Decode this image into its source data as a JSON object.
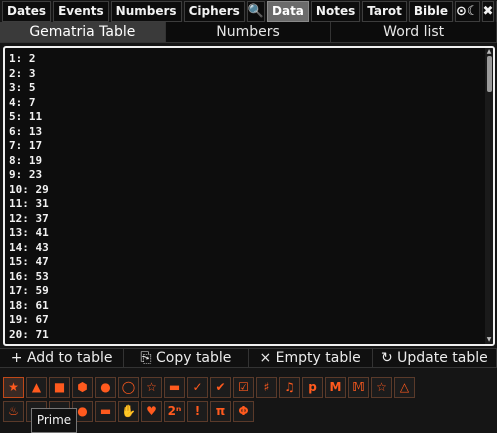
{
  "topnav": {
    "tabs": [
      {
        "label": "Dates",
        "active": false
      },
      {
        "label": "Events",
        "active": false
      },
      {
        "label": "Numbers",
        "active": false
      },
      {
        "label": "Ciphers",
        "active": false
      },
      {
        "label": "🔍",
        "icon": "search-icon",
        "active": false
      },
      {
        "label": "Data",
        "active": true
      },
      {
        "label": "Notes",
        "active": false
      },
      {
        "label": "Tarot",
        "active": false
      },
      {
        "label": "Bible",
        "active": false
      },
      {
        "label": "⊙☾",
        "icon": "sun-moon-icon",
        "active": false
      },
      {
        "label": "✖",
        "icon": "close-circle-icon",
        "active": false
      },
      {
        "label": "⚙",
        "icon": "gear-icon",
        "active": false
      }
    ]
  },
  "subtabs": [
    {
      "label": "Gematria Table",
      "active": true
    },
    {
      "label": "Numbers",
      "active": false
    },
    {
      "label": "Word list",
      "active": false
    }
  ],
  "table_lines": [
    "1: 2",
    "2: 3",
    "3: 5",
    "4: 7",
    "5: 11",
    "6: 13",
    "7: 17",
    "8: 19",
    "9: 23",
    "10: 29",
    "11: 31",
    "12: 37",
    "13: 41",
    "14: 43",
    "15: 47",
    "16: 53",
    "17: 59",
    "18: 61",
    "19: 67",
    "20: 71"
  ],
  "actions": {
    "add": "+ Add to table",
    "copy": "⎘ Copy table",
    "empty": "× Empty table",
    "update": "↻ Update table"
  },
  "icon_buttons_row1": [
    {
      "glyph": "★",
      "icon": "star-filled-icon",
      "active": true
    },
    {
      "glyph": "▲",
      "icon": "triangle-icon"
    },
    {
      "glyph": "■",
      "icon": "square-icon"
    },
    {
      "glyph": "⬢",
      "icon": "hexagon-icon"
    },
    {
      "glyph": "●",
      "icon": "dot-icon"
    },
    {
      "glyph": "◯",
      "icon": "circle-icon"
    },
    {
      "glyph": "☆",
      "icon": "star-outline-icon"
    },
    {
      "glyph": "▬",
      "icon": "car-side-icon"
    },
    {
      "glyph": "✓",
      "icon": "check-icon"
    },
    {
      "glyph": "✔",
      "icon": "double-check-icon"
    },
    {
      "glyph": "☑",
      "icon": "checkbox-icon"
    },
    {
      "glyph": "♯",
      "icon": "sharp-icon"
    },
    {
      "glyph": "♫",
      "icon": "music-note-icon"
    },
    {
      "glyph": "p",
      "icon": "letter-p-icon"
    },
    {
      "glyph": "M",
      "icon": "letter-m-icon"
    },
    {
      "glyph": "𝕄",
      "icon": "letter-m-outline-icon"
    },
    {
      "glyph": "☆",
      "icon": "small-star-icon"
    },
    {
      "glyph": "△",
      "icon": "triangle-outline-icon"
    }
  ],
  "icon_buttons_row2": [
    {
      "glyph": "♨",
      "icon": "palm-tree-icon"
    },
    {
      "glyph": "",
      "icon": "hidden-icon"
    },
    {
      "glyph": "",
      "icon": "hidden-icon"
    },
    {
      "glyph": "●",
      "icon": "circle-filled-icon"
    },
    {
      "glyph": "▬",
      "icon": "car-icon"
    },
    {
      "glyph": "✋",
      "icon": "hand-icon"
    },
    {
      "glyph": "♥",
      "icon": "heart-icon"
    },
    {
      "glyph": "2ⁿ",
      "icon": "power-of-two-icon"
    },
    {
      "glyph": "!",
      "icon": "factorial-icon"
    },
    {
      "glyph": "π",
      "icon": "pi-icon"
    },
    {
      "glyph": "Φ",
      "icon": "phi-icon"
    }
  ],
  "tooltip": "Prime",
  "colors": {
    "accent": "#ff5a1e",
    "background": "#151515"
  }
}
